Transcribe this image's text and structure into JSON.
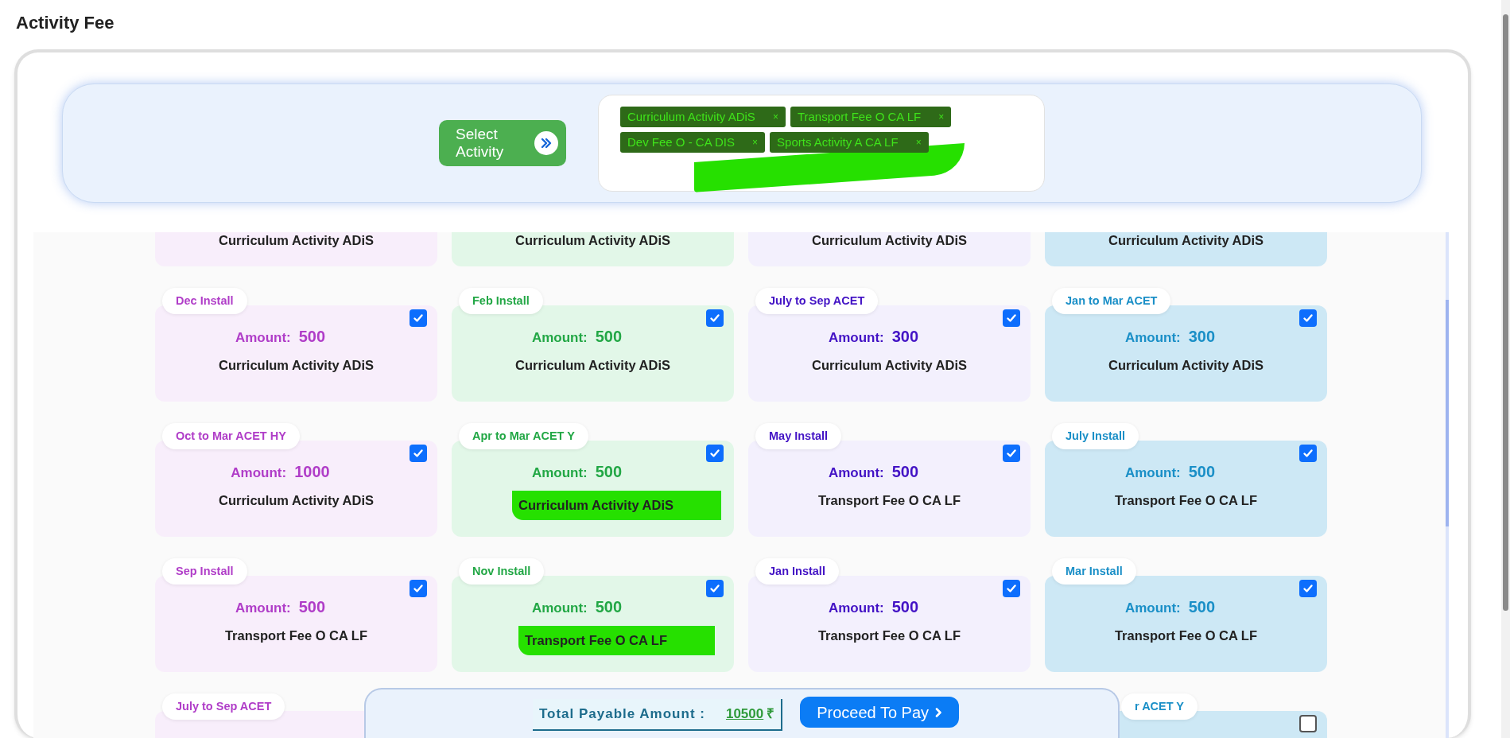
{
  "page_title": "Activity Fee",
  "select_button": {
    "label": "Select Activity"
  },
  "selected_tags": [
    {
      "label": "Curriculum Activity ADiS",
      "remove": "×",
      "highlighted": true
    },
    {
      "label": "Transport Fee O CA LF",
      "remove": "×",
      "highlighted": true
    },
    {
      "label": "Dev Fee O - CA DIS",
      "remove": "×",
      "highlighted": true
    },
    {
      "label": "Sports Activity A CA LF",
      "remove": "×",
      "highlighted": true
    }
  ],
  "fee_rows": [
    {
      "cards": [
        {
          "kind": "tail",
          "color": "#f8eefb",
          "description": "Curriculum Activity ADiS",
          "highlighted": false
        },
        {
          "kind": "tail",
          "color": "#e2f7e8",
          "description": "Curriculum Activity ADiS",
          "highlighted": false
        },
        {
          "kind": "tail",
          "color": "#f3f0fd",
          "description": "Curriculum Activity ADiS",
          "highlighted": false
        },
        {
          "kind": "tail",
          "color": "#cde8f5",
          "description": "Curriculum Activity ADiS",
          "highlighted": false
        }
      ]
    },
    {
      "cards": [
        {
          "kind": "full",
          "color": "#f8eefb",
          "label": "Dec Install",
          "amount_label": "Amount:",
          "amount": "500",
          "description": "Curriculum Activity ADiS",
          "checked": true,
          "highlighted": false
        },
        {
          "kind": "full",
          "color": "#e2f7e8",
          "label": "Feb Install",
          "amount_label": "Amount:",
          "amount": "500",
          "description": "Curriculum Activity ADiS",
          "checked": true,
          "highlighted": false
        },
        {
          "kind": "full",
          "color": "#f3f0fd",
          "label": "July to Sep ACET",
          "amount_label": "Amount:",
          "amount": "300",
          "description": "Curriculum Activity ADiS",
          "checked": true,
          "highlighted": false
        },
        {
          "kind": "full",
          "color": "#cde8f5",
          "label": "Jan to Mar ACET",
          "amount_label": "Amount:",
          "amount": "300",
          "description": "Curriculum Activity ADiS",
          "checked": true,
          "highlighted": false
        }
      ]
    },
    {
      "cards": [
        {
          "kind": "full",
          "color": "#f8eefb",
          "label": "Oct to Mar ACET HY",
          "amount_label": "Amount:",
          "amount": "1000",
          "description": "Curriculum Activity ADiS",
          "checked": true,
          "highlighted": false
        },
        {
          "kind": "full",
          "color": "#e2f7e8",
          "label": "Apr to Mar ACET Y",
          "amount_label": "Amount:",
          "amount": "500",
          "description": "Curriculum Activity ADiS",
          "checked": true,
          "highlighted": true
        },
        {
          "kind": "full",
          "color": "#f3f0fd",
          "label": "May Install",
          "amount_label": "Amount:",
          "amount": "500",
          "description": "Transport Fee O CA LF",
          "checked": true,
          "highlighted": false
        },
        {
          "kind": "full",
          "color": "#cde8f5",
          "label": "July Install",
          "amount_label": "Amount:",
          "amount": "500",
          "description": "Transport Fee O CA LF",
          "checked": true,
          "highlighted": false
        }
      ]
    },
    {
      "cards": [
        {
          "kind": "full",
          "color": "#f8eefb",
          "label": "Sep Install",
          "amount_label": "Amount:",
          "amount": "500",
          "description": "Transport Fee O CA LF",
          "checked": true,
          "highlighted": false
        },
        {
          "kind": "full",
          "color": "#e2f7e8",
          "label": "Nov Install",
          "amount_label": "Amount:",
          "amount": "500",
          "description": "Transport Fee O CA LF",
          "checked": true,
          "highlighted": true
        },
        {
          "kind": "full",
          "color": "#f3f0fd",
          "label": "Jan Install",
          "amount_label": "Amount:",
          "amount": "500",
          "description": "Transport Fee O CA LF",
          "checked": true,
          "highlighted": false
        },
        {
          "kind": "full",
          "color": "#cde8f5",
          "label": "Mar Install",
          "amount_label": "Amount:",
          "amount": "500",
          "description": "Transport Fee O CA LF",
          "checked": true,
          "highlighted": false
        }
      ]
    },
    {
      "cards": [
        {
          "kind": "head",
          "color": "#f8eefb",
          "label": "July to Sep ACET"
        },
        {
          "kind": "head",
          "color": "#cde8f5",
          "label": "r ACET Y",
          "checked": false
        }
      ]
    }
  ],
  "footer": {
    "total_label": "Total Payable Amount :",
    "total_amount": "10500",
    "currency": "₹",
    "pay_button": "Proceed To Pay"
  }
}
